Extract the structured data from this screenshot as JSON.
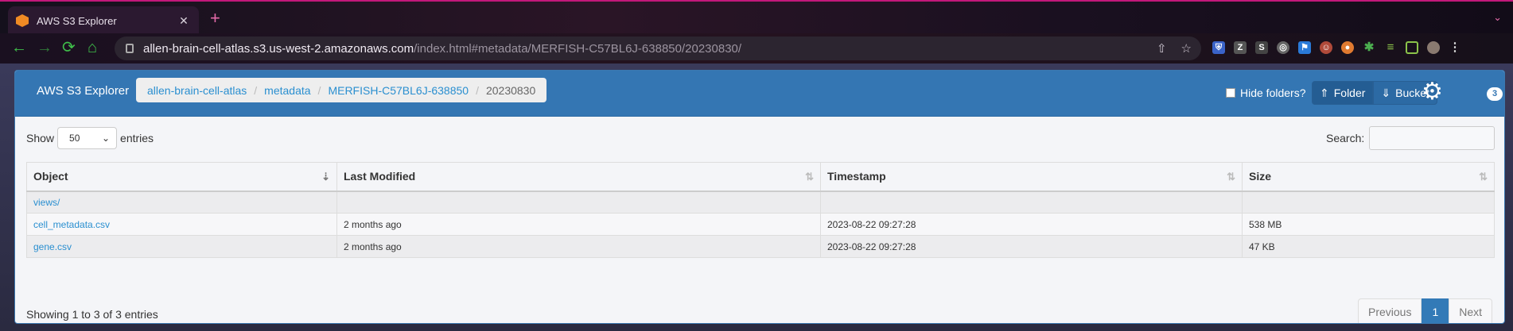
{
  "browser": {
    "tab_title": "AWS S3 Explorer",
    "url_host": "allen-brain-cell-atlas.s3.us-west-2.amazonaws.com",
    "url_path": "/index.html#metadata/MERFISH-C57BL6J-638850/20230830/"
  },
  "header": {
    "brand": "AWS S3 Explorer",
    "breadcrumb": [
      "allen-brain-cell-atlas",
      "metadata",
      "MERFISH-C57BL6J-638850",
      "20230830"
    ],
    "hide_folders_label": "Hide folders?",
    "folder_label": "Folder",
    "bucket_label": "Bucket",
    "badge_count": "3"
  },
  "controls": {
    "show_label": "Show",
    "entries_value": "50",
    "entries_label": "entries",
    "search_label": "Search:"
  },
  "table": {
    "headers": [
      "Object",
      "Last Modified",
      "Timestamp",
      "Size"
    ],
    "rows": [
      {
        "object": "views/",
        "last_modified": "",
        "timestamp": "",
        "size": ""
      },
      {
        "object": "cell_metadata.csv",
        "last_modified": "2 months ago",
        "timestamp": "2023-08-22 09:27:28",
        "size": "538 MB"
      },
      {
        "object": "gene.csv",
        "last_modified": "2 months ago",
        "timestamp": "2023-08-22 09:27:28",
        "size": "47 KB"
      }
    ]
  },
  "footer": {
    "info": "Showing 1 to 3 of 3 entries",
    "previous": "Previous",
    "page": "1",
    "next": "Next"
  },
  "colors": {
    "accent": "#3476b3",
    "link": "#2a8fd0",
    "nav_green": "#3fbe4a"
  }
}
